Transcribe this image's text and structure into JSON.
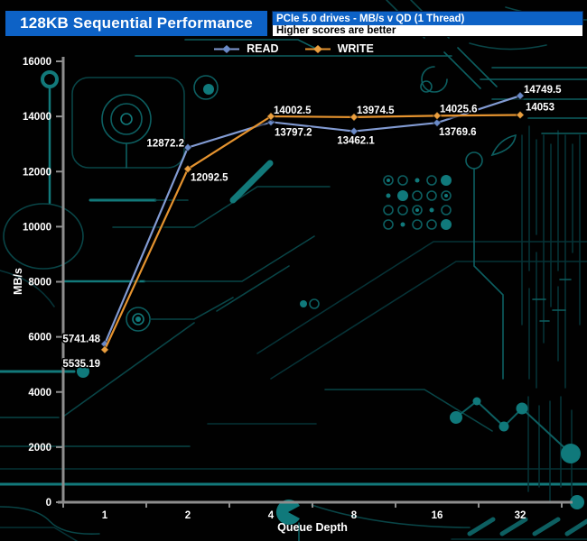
{
  "header": {
    "title": "128KB Sequential Performance",
    "subtitle": "PCIe 5.0 drives - MB/s v QD (1 Thread)",
    "note": "Higher scores are better"
  },
  "chart_data": {
    "type": "line",
    "title": "128KB Sequential Performance",
    "subtitle": "PCIe 5.0 drives - MB/s v QD (1 Thread)",
    "note": "Higher scores are better",
    "xlabel": "Queue Depth",
    "ylabel": "MB/s",
    "x_categories": [
      "1",
      "2",
      "4",
      "8",
      "16",
      "32"
    ],
    "ylim": [
      0,
      16000
    ],
    "ytick_step": 2000,
    "grid": false,
    "legend_position": "top-center",
    "marker_shape": "diamond",
    "series": [
      {
        "name": "READ",
        "color": "#829bd3",
        "marker_color": "#6a8ac8",
        "values": [
          5741.48,
          12872.2,
          13797.2,
          13462.1,
          13769.6,
          14749.5
        ],
        "labels": [
          "5741.48",
          "12872.2",
          "13797.2",
          "13462.1",
          "13769.6",
          "14749.5"
        ]
      },
      {
        "name": "WRITE",
        "color": "#e5932f",
        "marker_color": "#eb9f3e",
        "values": [
          5535.19,
          12092.5,
          14002.5,
          13974.5,
          14025.6,
          14053
        ],
        "labels": [
          "5535.19",
          "12092.5",
          "14002.5",
          "13974.5",
          "14025.6",
          "14053"
        ]
      }
    ]
  },
  "colors": {
    "background": "#010101",
    "header_blue": "#0d62c6",
    "note_background": "#ffffff",
    "axis_gray": "#8e8e8e",
    "tick_text": "#ffffff",
    "circuit_bright": "#12797a",
    "circuit_mid": "#0d5f61",
    "circuit_dim": "#094547"
  }
}
